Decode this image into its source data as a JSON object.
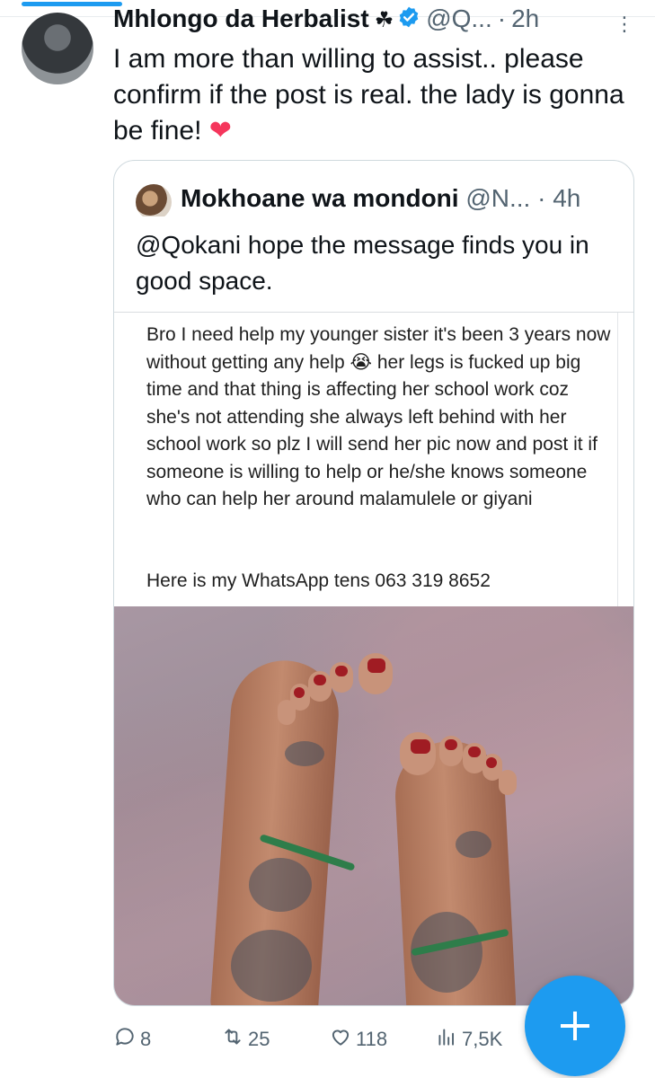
{
  "header": {
    "name": "Mhlongo da Herbalist",
    "emoji": "☘",
    "handle": "@Q...",
    "time": "2h",
    "dot": "·"
  },
  "tweet": {
    "text": "I am more than willing to assist.. please confirm if the post is real. the lady is gonna be fine!",
    "emoji": "❤"
  },
  "quote": {
    "name": "Mokhoane wa mondoni",
    "handle": "@N...",
    "time": "4h",
    "dot": "·",
    "text": "@Qokani hope the message finds you in good space.",
    "screenshot_text": "Bro I need help my younger sister it's been 3 years now without getting any help 😭 her legs is fucked up big time and that thing is affecting her school work coz she's not attending she always left behind with her school work so plz I will send her pic now and post it if someone is willing to help or he/she knows someone who can help her around malamulele or giyani",
    "screenshot_whatsapp": "Here is my WhatsApp tens 063 319 8652"
  },
  "actions": {
    "replies": "8",
    "reposts": "25",
    "likes": "118",
    "views": "7,5K"
  },
  "colors": {
    "accent": "#1d9bf0",
    "heart": "#f5365c",
    "secondary_text": "#536471"
  },
  "icons": {
    "reply": "reply-icon",
    "repost": "repost-icon",
    "like": "heart-icon",
    "views": "views-icon",
    "compose": "plus-icon",
    "more": "more-icon",
    "verified": "verified-badge-icon"
  }
}
